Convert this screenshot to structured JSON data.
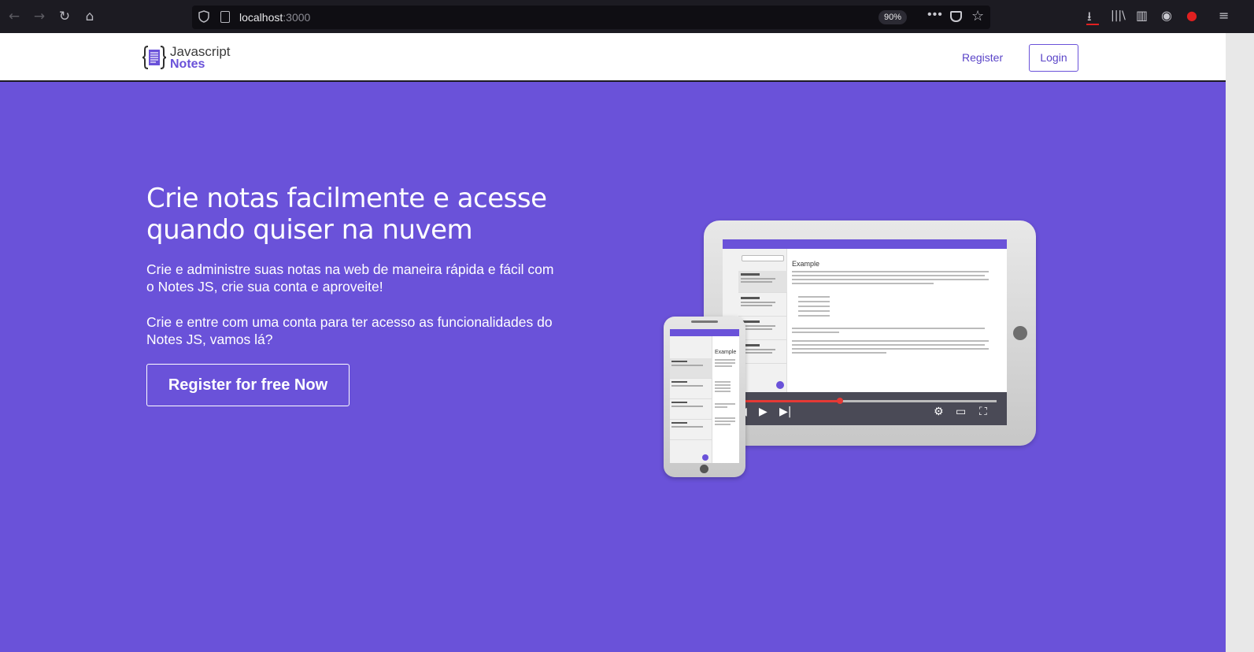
{
  "browser": {
    "url_host": "localhost",
    "url_port": ":3000",
    "zoom": "90%"
  },
  "brand": {
    "line1": "Javascript",
    "line2": "Notes"
  },
  "nav": {
    "register_label": "Register",
    "login_label": "Login"
  },
  "hero": {
    "title": "Crie notas facilmente e acesse quando quiser na nuvem",
    "paragraph1": "Crie e administre suas notas na web de maneira rápida e fácil com o Notes JS, crie sua conta e aproveite!",
    "paragraph2": "Crie e entre com uma conta para ter acesso as funcionalidades do Notes JS, vamos lá?",
    "cta_label": "Register for free Now"
  },
  "mockup": {
    "note_title": "Example"
  },
  "colors": {
    "accent": "#6a52d9",
    "chrome_bg": "#1c1b22",
    "progress": "#e53935"
  }
}
